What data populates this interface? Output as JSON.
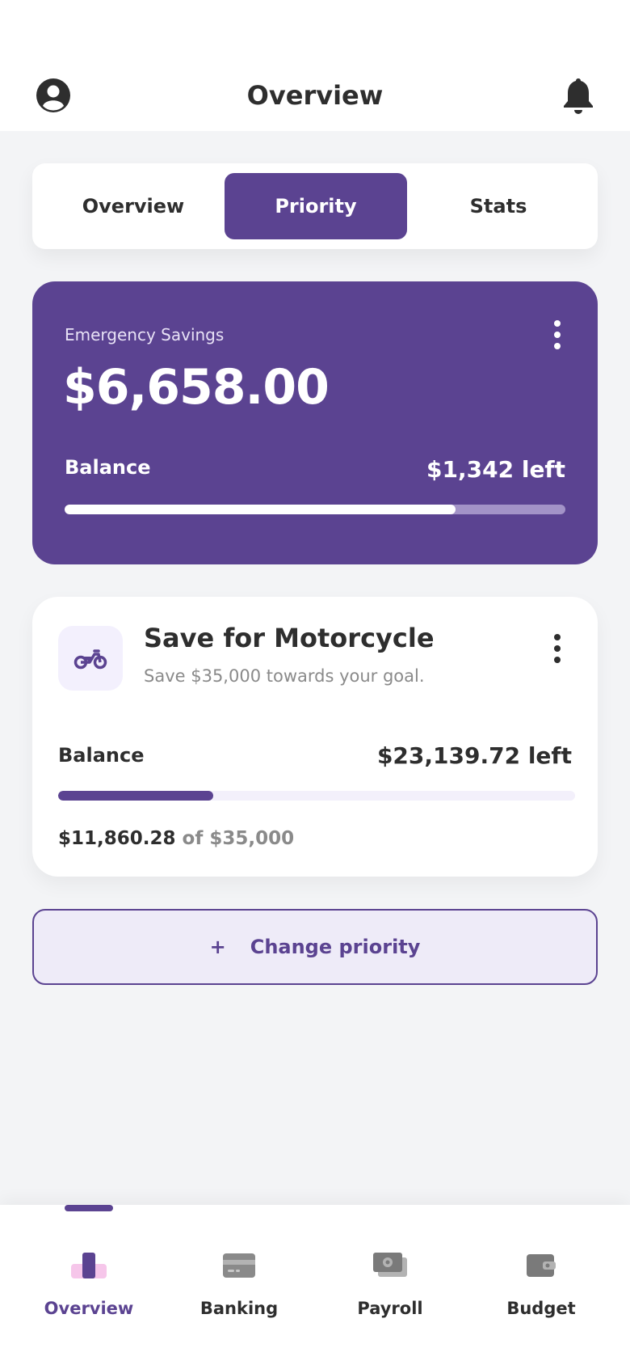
{
  "header": {
    "title": "Overview",
    "profile_icon": "user-circle-icon",
    "notification_icon": "bell-icon"
  },
  "tabs": [
    {
      "label": "Overview",
      "active": false
    },
    {
      "label": "Priority",
      "active": true
    },
    {
      "label": "Stats",
      "active": false
    }
  ],
  "savings": {
    "label": "Emergency Savings",
    "amount": "$6,658.00",
    "balance_label": "Balance",
    "left_text": "$1,342 left",
    "progress": 0.78
  },
  "goal": {
    "icon": "motorcycle-icon",
    "title": "Save for Motorcycle",
    "subtitle": "Save $35,000 towards your goal.",
    "balance_label": "Balance",
    "left_text": "$23,139.72 left",
    "progress": 0.3,
    "current": "$11,860.28",
    "of_text": "of $35,000"
  },
  "change_priority": {
    "plus": "+",
    "label": "Change priority"
  },
  "bottom_nav": [
    {
      "label": "Overview",
      "icon": "overview-icon",
      "active": true
    },
    {
      "label": "Banking",
      "icon": "card-icon",
      "active": false
    },
    {
      "label": "Payroll",
      "icon": "cash-icon",
      "active": false
    },
    {
      "label": "Budget",
      "icon": "wallet-icon",
      "active": false
    }
  ],
  "colors": {
    "accent": "#5b4391",
    "accent_light": "#eeebf8",
    "background": "#f3f4f6"
  }
}
